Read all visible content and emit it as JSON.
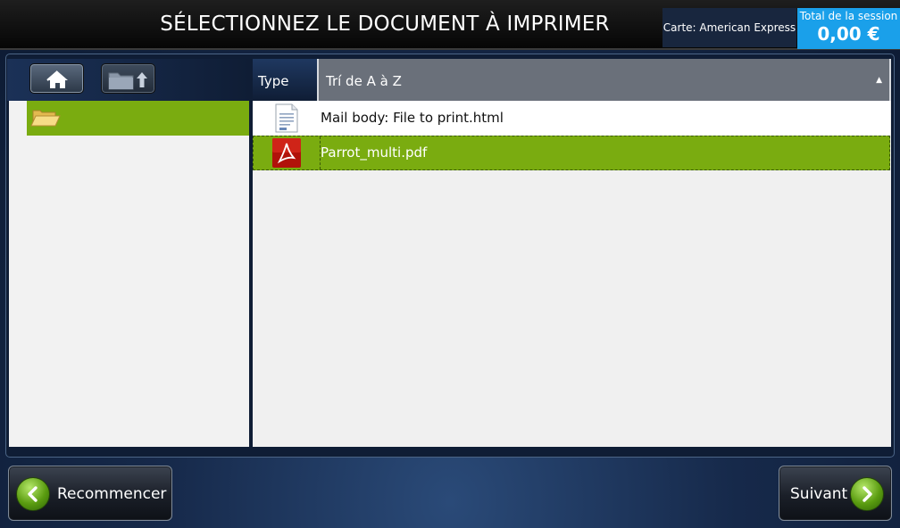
{
  "header": {
    "title": "SÉLECTIONNEZ LE DOCUMENT À IMPRIMER",
    "card": "Carte: American Express",
    "total_label": "Total de la session",
    "total_value": "0,00 €"
  },
  "toolbar": {
    "home_icon": "home-icon",
    "folder_up_icon": "folder-up-icon"
  },
  "tree": {
    "items": [
      {
        "icon": "open-folder-icon",
        "label": "",
        "selected": true
      }
    ]
  },
  "file_list": {
    "columns": {
      "type": "Type",
      "sort": "Trí de A à Z"
    },
    "rows": [
      {
        "icon": "html-document-icon",
        "name": "Mail body: File to print.html",
        "selected": false
      },
      {
        "icon": "pdf-icon",
        "name": "Parrot_multi.pdf",
        "selected": true
      }
    ]
  },
  "buttons": {
    "restart": "Recommencer",
    "next": "Suivant"
  },
  "colors": {
    "accent_blue": "#1aa0ea",
    "selection_green": "#7aac10"
  }
}
